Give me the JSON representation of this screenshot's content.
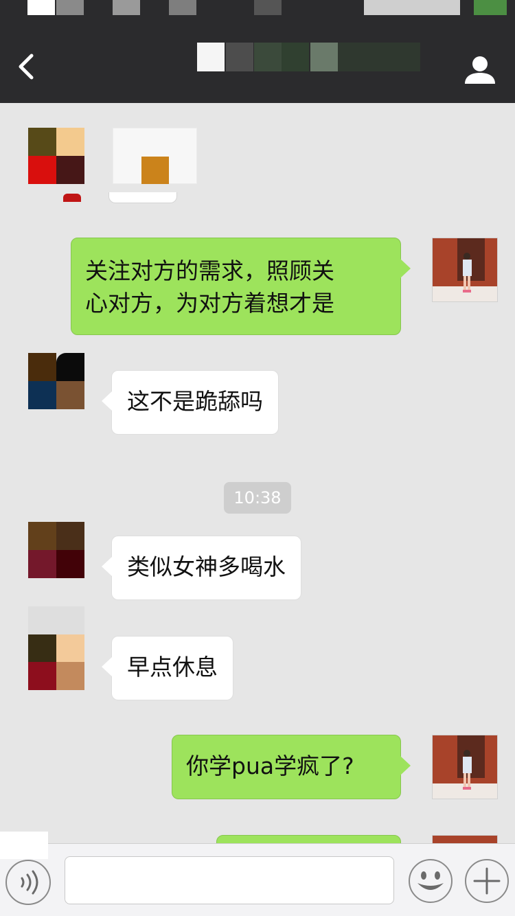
{
  "header": {
    "title": "",
    "back_icon": "chevron-left-icon",
    "profile_icon": "person-icon"
  },
  "messages": [
    {
      "side": "left",
      "text": "",
      "avatar_colors": [
        "#574a18",
        "#f3ca8e",
        "#d90f0d",
        "#461717"
      ]
    },
    {
      "side": "right",
      "lines": [
        "关注对方的需求，照顾关",
        "心对方，为对方着想才是"
      ]
    },
    {
      "side": "left",
      "text": "这不是跪舔吗",
      "avatar_colors": [
        "#4a2c0c",
        "#0b0b0b",
        "#0d3054",
        "#7a5232"
      ]
    },
    {
      "side": "left",
      "text": "类似女神多喝水",
      "avatar_colors": [
        "#62401b",
        "#4a2f19",
        "#74182b",
        "#420208"
      ]
    },
    {
      "side": "left",
      "text": "早点休息",
      "avatar_colors": [
        "#dedede",
        "#dedede",
        "#372d14",
        "#f3ca9a",
        "#8d0e1d",
        "#c38a5d"
      ]
    },
    {
      "side": "right",
      "text": "你学pua学疯了?"
    }
  ],
  "timestamp": "10:38",
  "input": {
    "value": "",
    "voice_icon": "voice-icon",
    "emoji_icon": "emoji-icon",
    "plus_icon": "plus-icon"
  },
  "colors": {
    "background": "#e6e6e6",
    "nav_bar": "#2b2b2d",
    "bubble_sent": "#9de35c",
    "bubble_received": "#ffffff"
  }
}
